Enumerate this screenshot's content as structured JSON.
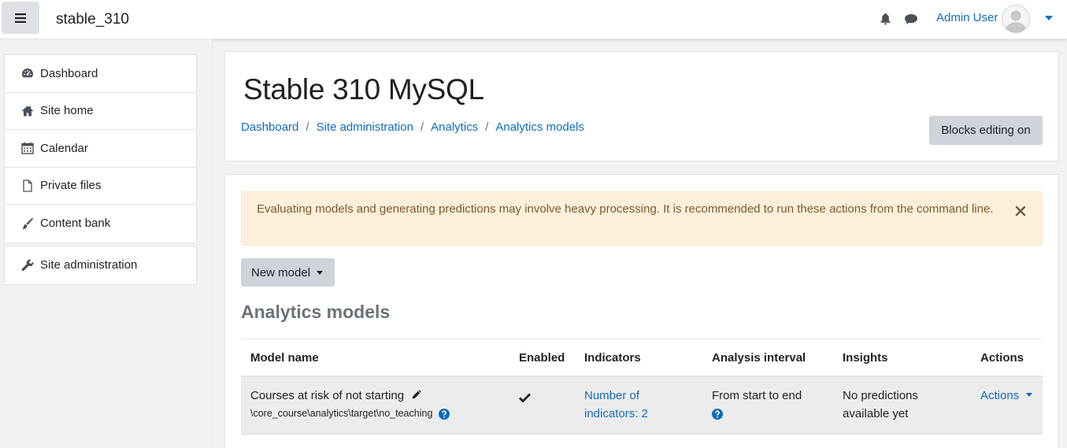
{
  "navbar": {
    "site_name": "stable_310",
    "user_name": "Admin User",
    "icons": [
      "menu-icon",
      "bell-icon",
      "chat-icon",
      "avatar",
      "chevron-down-icon"
    ]
  },
  "drawer": {
    "items": [
      {
        "label": "Dashboard",
        "icon": "dashboard-icon"
      },
      {
        "label": "Site home",
        "icon": "home-icon"
      },
      {
        "label": "Calendar",
        "icon": "calendar-icon"
      },
      {
        "label": "Private files",
        "icon": "file-icon"
      },
      {
        "label": "Content bank",
        "icon": "brush-icon"
      }
    ],
    "admin_item": {
      "label": "Site administration",
      "icon": "wrench-icon"
    }
  },
  "header": {
    "title": "Stable 310 MySQL",
    "breadcrumb": [
      "Dashboard",
      "Site administration",
      "Analytics",
      "Analytics models"
    ],
    "breadcrumb_sep": "/",
    "blocks_editing_label": "Blocks editing on"
  },
  "alert": {
    "text": "Evaluating models and generating predictions may involve heavy processing. It is recommended to run these actions from the command line."
  },
  "new_model_label": "New model",
  "section_title": "Analytics models",
  "table": {
    "headers": [
      "Model name",
      "Enabled",
      "Indicators",
      "Analysis interval",
      "Insights",
      "Actions"
    ],
    "rows": [
      {
        "model_name": "Courses at risk of not starting",
        "target": "\\core_course\\analytics\\target\\no_teaching",
        "enabled": true,
        "indicators_line1": "Number of",
        "indicators_line2": "indicators: 2",
        "interval": "From start to end",
        "insights_line1": "No predictions",
        "insights_line2": "available yet",
        "actions_label": "Actions"
      }
    ]
  },
  "colors": {
    "link": "#0f6cbf",
    "alert_bg": "#fcefdc",
    "alert_text": "#7d5a29",
    "button_bg": "#ced4da",
    "help_icon": "#0f6cbf"
  }
}
